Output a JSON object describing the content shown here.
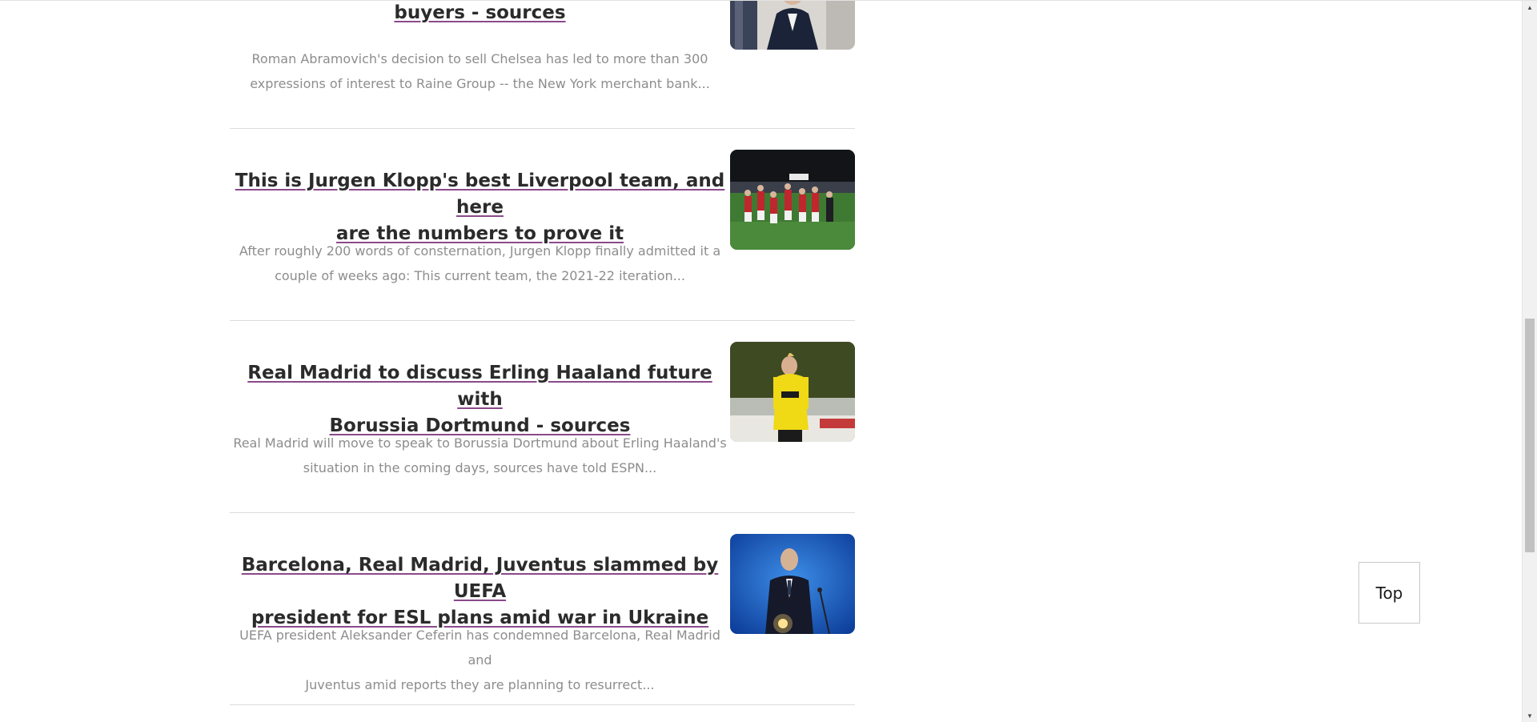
{
  "articles": [
    {
      "headline": "buyers - sources",
      "summary_line1": "Roman Abramovich's decision to sell Chelsea has led to more than 300",
      "summary_line2": "expressions of interest to Raine Group -- the New York merchant bank...",
      "image": "chelsea-owner-photo"
    },
    {
      "headline_line1": "This is Jurgen Klopp's best Liverpool team, and here",
      "headline_line2": "are the numbers to prove it",
      "summary_line1": "After roughly 200 words of consternation, Jurgen Klopp finally admitted it a",
      "summary_line2": "couple of weeks ago: This current team, the 2021-22 iteration...",
      "image": "liverpool-celebration-photo"
    },
    {
      "headline_line1": "Real Madrid to discuss Erling Haaland future with",
      "headline_line2": "Borussia Dortmund - sources",
      "summary_line1": "Real Madrid will move to speak to Borussia Dortmund about Erling Haaland's",
      "summary_line2": "situation in the coming days, sources have told ESPN...",
      "image": "haaland-photo"
    },
    {
      "headline_line1": "Barcelona, Real Madrid, Juventus slammed by UEFA",
      "headline_line2": "president for ESL plans amid war in Ukraine",
      "summary_line1": "UEFA president Aleksander Ceferin has condemned Barcelona, Real Madrid and",
      "summary_line2": "Juventus amid reports they are planning to resurrect...",
      "image": "ceferin-podium-photo"
    }
  ],
  "top_button": {
    "label": "Top"
  },
  "colors": {
    "headline": "#2b2b2b",
    "summary": "#8d8d8d",
    "divider": "#dcdcdc"
  }
}
